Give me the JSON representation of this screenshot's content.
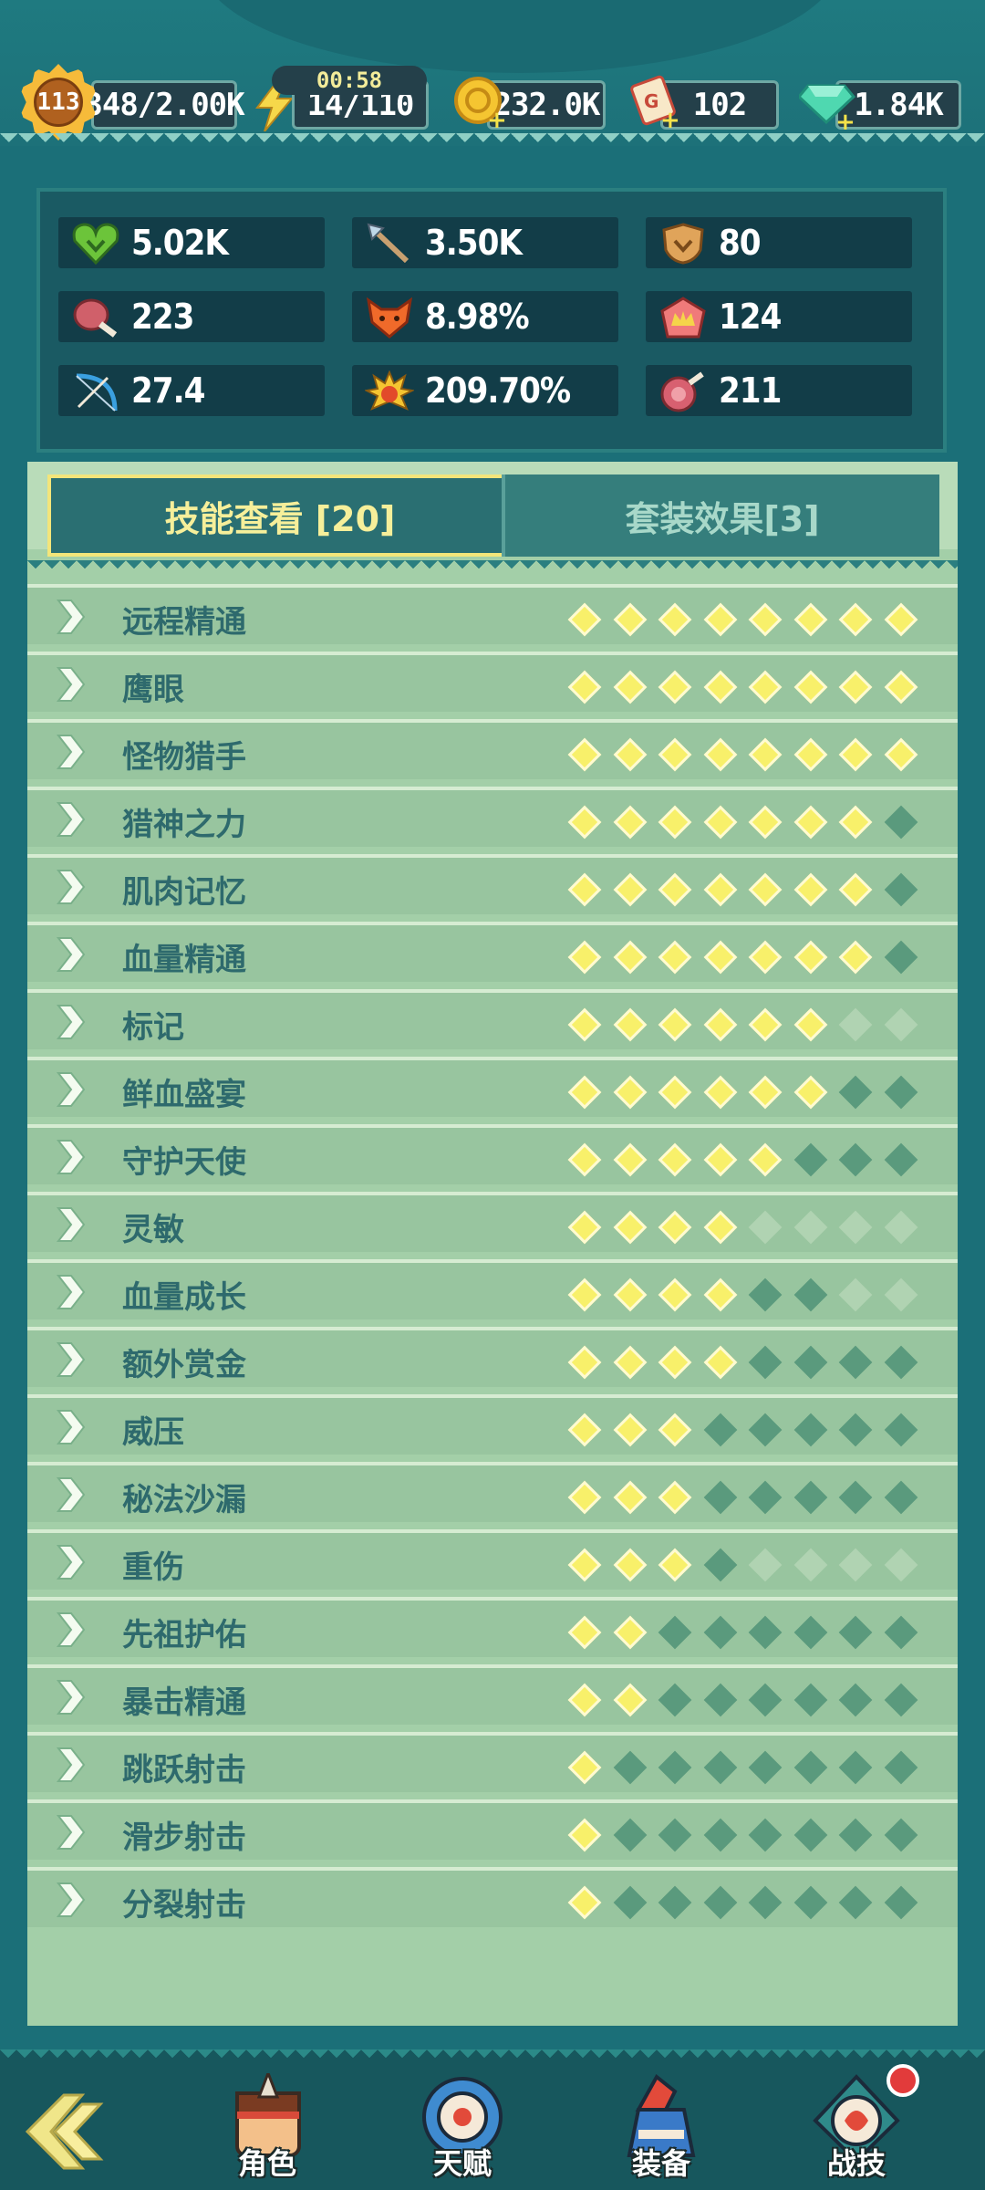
{
  "topbar": {
    "level": "113",
    "exp": "348/2.00K",
    "energy": "14/110",
    "energy_timer": "00:58",
    "gold": "232.0K",
    "tickets": "102",
    "gems": "1.84K"
  },
  "stats": [
    {
      "icon": "heart-icon",
      "value": "5.02K"
    },
    {
      "icon": "spear-icon",
      "value": "3.50K"
    },
    {
      "icon": "shield-icon",
      "value": "80"
    },
    {
      "icon": "meat-icon",
      "value": "223"
    },
    {
      "icon": "fox-icon",
      "value": "8.98%"
    },
    {
      "icon": "crown-icon",
      "value": "124"
    },
    {
      "icon": "bow-icon",
      "value": "27.4"
    },
    {
      "icon": "spiky-icon",
      "value": "209.70%"
    },
    {
      "icon": "ham-icon",
      "value": "211"
    }
  ],
  "tabs": {
    "skills": "技能查看 [20]",
    "set_effects": "套装效果[3]"
  },
  "skills": [
    {
      "name": "远程精通",
      "levels": [
        1,
        1,
        1,
        1,
        1,
        1,
        1,
        1
      ]
    },
    {
      "name": "鹰眼",
      "levels": [
        1,
        1,
        1,
        1,
        1,
        1,
        1,
        1
      ]
    },
    {
      "name": "怪物猎手",
      "levels": [
        1,
        1,
        1,
        1,
        1,
        1,
        1,
        1
      ]
    },
    {
      "name": "猎神之力",
      "levels": [
        1,
        1,
        1,
        1,
        1,
        1,
        1,
        0
      ]
    },
    {
      "name": "肌肉记忆",
      "levels": [
        1,
        1,
        1,
        1,
        1,
        1,
        1,
        0
      ]
    },
    {
      "name": "血量精通",
      "levels": [
        1,
        1,
        1,
        1,
        1,
        1,
        1,
        0
      ]
    },
    {
      "name": "标记",
      "levels": [
        1,
        1,
        1,
        1,
        1,
        1,
        2,
        2
      ]
    },
    {
      "name": "鲜血盛宴",
      "levels": [
        1,
        1,
        1,
        1,
        1,
        1,
        0,
        0
      ]
    },
    {
      "name": "守护天使",
      "levels": [
        1,
        1,
        1,
        1,
        1,
        0,
        0,
        0
      ]
    },
    {
      "name": "灵敏",
      "levels": [
        1,
        1,
        1,
        1,
        2,
        2,
        2,
        2
      ]
    },
    {
      "name": "血量成长",
      "levels": [
        1,
        1,
        1,
        1,
        0,
        0,
        2,
        2
      ]
    },
    {
      "name": "额外赏金",
      "levels": [
        1,
        1,
        1,
        1,
        0,
        0,
        0,
        0
      ]
    },
    {
      "name": "威压",
      "levels": [
        1,
        1,
        1,
        0,
        0,
        0,
        0,
        0
      ]
    },
    {
      "name": "秘法沙漏",
      "levels": [
        1,
        1,
        1,
        0,
        0,
        0,
        0,
        0
      ]
    },
    {
      "name": "重伤",
      "levels": [
        1,
        1,
        1,
        0,
        2,
        2,
        2,
        2
      ]
    },
    {
      "name": "先祖护佑",
      "levels": [
        1,
        1,
        0,
        0,
        0,
        0,
        0,
        0
      ]
    },
    {
      "name": "暴击精通",
      "levels": [
        1,
        1,
        0,
        0,
        0,
        0,
        0,
        0
      ]
    },
    {
      "name": "跳跃射击",
      "levels": [
        1,
        0,
        0,
        0,
        0,
        0,
        0,
        0
      ]
    },
    {
      "name": "滑步射击",
      "levels": [
        1,
        0,
        0,
        0,
        0,
        0,
        0,
        0
      ]
    },
    {
      "name": "分裂射击",
      "levels": [
        1,
        0,
        0,
        0,
        0,
        0,
        0,
        0
      ]
    }
  ],
  "nav": {
    "character": "角色",
    "talent": "天赋",
    "equipment": "装备",
    "combat_skills": "战技"
  },
  "colors": {
    "pip_on": "#f8f06a",
    "pip_off": "#5a9a7d",
    "panel_bg": "#a3cfa8",
    "page_bg": "#1b6f78"
  }
}
